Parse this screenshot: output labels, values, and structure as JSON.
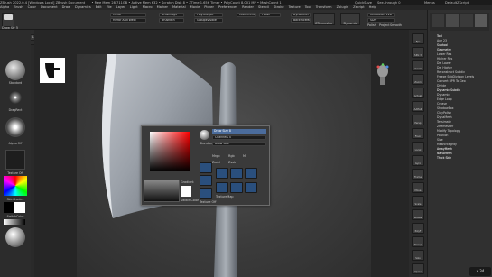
{
  "titlebar": {
    "title": "ZBrush 2022.0.4 [Windows Local] ZBrush Document",
    "stats": "• Free Mem 28.711GB • Active Mem 632 • Scratch Disk 8 • ZTime 1.656 Timer • PolyCount 8.001 MP • MeshCount 1",
    "quicksave": "QuickSave",
    "seethrough": "See-through 0",
    "menus": "Menus",
    "defaultscript": "DefaultZScript"
  },
  "menubar": {
    "items": [
      "Alpha",
      "Brush",
      "Color",
      "Document",
      "Draw",
      "Dynamics",
      "Edit",
      "File",
      "Layer",
      "Light",
      "Macro",
      "Marker",
      "Material",
      "Movie",
      "Picker",
      "Preferences",
      "Render",
      "Stencil",
      "Stroke",
      "Texture",
      "Tool",
      "Transform",
      "Zplugin",
      "Zscript",
      "Help"
    ]
  },
  "topshelf": {
    "mirror": "Mirror",
    "mirror_weld": "Mirror And Weld",
    "brushinfo": "BrushBtn",
    "splitgroups": "Brushflags",
    "polygroupit": "PolyGroupIt",
    "groupvisible": "GroupsVisible",
    "hideunmasked": "Hide Unmasked",
    "backfacemask": "BackfaceMask",
    "zremesher": "ZRemesher",
    "dynamesh": "DynaMesh",
    "resolution_label": "Resolution",
    "resolution_value": "128",
    "sdiv_label": "SDiv",
    "polish": "Polish",
    "project": "Project",
    "smooth": "Smooth",
    "lightbox": "LightBox",
    "liveboolean": "Live Boolean",
    "draw": "Draw",
    "move": "Move",
    "scale": "Scale",
    "rotate": "Rotate",
    "mrgb": "Mrgb",
    "rgb": "Rgb",
    "m": "M",
    "zadd": "Zadd",
    "zsub": "Zsub",
    "zcut": "Zcut",
    "z_intensity": "Z Intensity 25",
    "draw_size": "Draw Size 70",
    "focal_shift": "Focal Shift 0",
    "rgb_intensity": "Rgb Intensity 100",
    "active_points": "ActivePoints: 8,001 Mil",
    "total_points": "TotalPoints: 15.481 Mil",
    "dynamic": "Dynamic",
    "edit": "Edit",
    "channels": "Channels 4",
    "draw_size_label": "Draw Size 8"
  },
  "leftbar": {
    "brush_label": "Standard",
    "stroke_label": "DragRect",
    "alpha_label": "Alpha Off",
    "texture_label": "Texture Off",
    "material_label": "SkinShade4",
    "gradient_label": "Gradient",
    "switchcolor_label": "SwitchColor",
    "alternate_label": "Alternate"
  },
  "canvas": {
    "floating_label": "Draw Str 5"
  },
  "popup": {
    "header": "Draw Size",
    "slider_label": "Draw Size 8",
    "channels": "Channels 4",
    "standard": "Standard",
    "mrgb": "Mrgb",
    "rgb": "Rgb",
    "m": "M",
    "zadd": "Zadd",
    "zsub": "Zsub",
    "gradient": "Gradient",
    "switchcolor": "SwitchColor",
    "swatch_label": "Swatch",
    "texturemap": "TextureMap",
    "texture_off": "Texture Off",
    "mask": "Mask",
    "polyframe": "PolyF"
  },
  "rightpanel": {
    "top_label": "Tool",
    "tabs": [
      "Load Tool",
      "Save As",
      "Copy Tool",
      "Paste Tool",
      "Import",
      "Export",
      "Clone",
      "Make PolyMesh3D",
      "GoZ",
      "All",
      "Visible",
      "R"
    ],
    "lightbox_tools": "Lightbox ▸ Tools",
    "current_tool": "Axe 23",
    "subtools": [
      "Subtool",
      "Geometry",
      "Lower Res",
      "Higher Res",
      "Del Lower",
      "Del Higher",
      "Reconstruct Subdiv",
      "Freeze SubDivision Levels",
      "Convert BPR To Geo"
    ],
    "divide": "Divide",
    "dynamic_subdiv": "Dynamic Subdiv",
    "sections": [
      "Dynamic",
      "Edge Loop",
      "Crease",
      "ShadowBox",
      "ClayPolish",
      "DynaMesh",
      "Tessimate",
      "ZRemesher",
      "Modify Topology",
      "Position",
      "Size",
      "MeshIntegrity"
    ],
    "bottom": [
      "ArrayMesh",
      "NanoMesh",
      "Thick Skin"
    ]
  },
  "rightshelf": {
    "items": [
      "Bpr",
      "SPix 3",
      "Scroll",
      "Zoom",
      "Actual",
      "AAHalf",
      "Persp",
      "Floor",
      "Local",
      "Gyro",
      "Frame",
      "Move",
      "Scale",
      "Rotate",
      "PolyF",
      "Transp",
      "Solo",
      "Xpose"
    ]
  },
  "status": {
    "zoom": "x 34"
  },
  "colors": {
    "accent_blue": "#3d5f92",
    "panel": "#303030",
    "background": "#2a2a2a"
  }
}
